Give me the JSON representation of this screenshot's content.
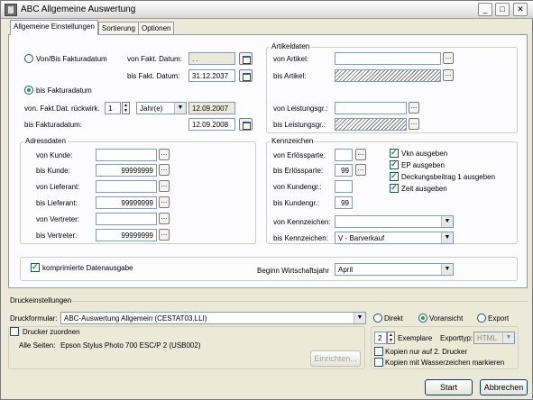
{
  "window": {
    "title": "ABC Allgemeine Auswertung",
    "minimize": "_",
    "maximize": "□",
    "close": "✕"
  },
  "tabs": [
    {
      "label": "Allgemeine Einstellungen"
    },
    {
      "label": "Sortierung"
    },
    {
      "label": "Optionen"
    }
  ],
  "date_section": {
    "radio_range": "Von/Bis Fakturadatum",
    "radio_until": "bis Fakturadatum",
    "von_fakt_label": "von Fakt. Datum:",
    "von_fakt_value": ". .",
    "bis_fakt_label": "bis Fakt. Datum:",
    "bis_fakt_value": "31.12.2037",
    "back_label": "von. Fakt.Dat. rückwirk.",
    "back_value": "1",
    "back_unit": "Jahr(e)",
    "back_date": "12.09.2007",
    "faktura_label": "bis Fakturadatum:",
    "faktura_value": "12.09.2008"
  },
  "artikel": {
    "title": "Artikeldaten",
    "von_artikel": "von Artikel:",
    "bis_artikel": "bis Artikel:",
    "von_leistung": "von Leistungsgr.:",
    "bis_leistung": "bis Leistungsgr.:"
  },
  "adress": {
    "title": "Adressdaten",
    "von_kunde": "von Kunde:",
    "bis_kunde": "bis Kunde:",
    "bis_kunde_value": "99999999",
    "von_lieferant": "von Lieferant:",
    "bis_lieferant": "bis Lieferant:",
    "bis_lieferant_value": "99999999",
    "von_vertreter": "von Vertreter:",
    "bis_vertreter": "bis Vertreter:",
    "bis_vertreter_value": "99999999"
  },
  "kennzeichen": {
    "title": "Kennzeichen",
    "von_erloes": "von Erlössparte:",
    "bis_erloes": "bis Erlössparte:",
    "bis_erloes_value": "99",
    "von_kundengr": "von Kundengr.:",
    "bis_kundengr": "bis Kundengr.:",
    "bis_kundengr_value": "99",
    "von_kennz": "von Kennzeichen:",
    "bis_kennz": "bis Kennzeichen:",
    "bis_kennz_value": "V - Barverkauf",
    "chk_vkn": "Vkn ausgeben",
    "chk_ep": "EP ausgeben",
    "chk_db": "Deckungsbeitrag 1 ausgeben",
    "chk_zeit": "Zeit ausgeben"
  },
  "bottom": {
    "komprimiert": "komprimierte Datenausgabe",
    "wirtschaftsjahr_label": "Beginn Wirtschaftsjahr",
    "wirtschaftsjahr_value": "April"
  },
  "druck": {
    "title": "Druckeinstellungen",
    "formular_label": "Druckformular:",
    "formular_value": "ABC-Auswertung Allgemein (CESTAT03.LLI)",
    "radio_direkt": "Direkt",
    "radio_voransicht": "Voransicht",
    "radio_export": "Export",
    "drucker_zuordnen": "Drucker zuordnen",
    "alle_seiten_label": "Alle Seiten:",
    "alle_seiten_value": "Epson Stylus Photo 700 ESC/P 2 (USB002)",
    "einrichten": "Einrichten...",
    "exemplare_value": "2",
    "exemplare_label": "Exemplare",
    "exporttyp_label": "Exporttyp:",
    "exporttyp_value": "HTML",
    "kopien_2": "Kopien nur auf 2. Drucker",
    "kopien_wasser": "Kopien mit Wasserzeichen markieren"
  },
  "buttons": {
    "start": "Start",
    "abbrechen": "Abbrechen"
  }
}
